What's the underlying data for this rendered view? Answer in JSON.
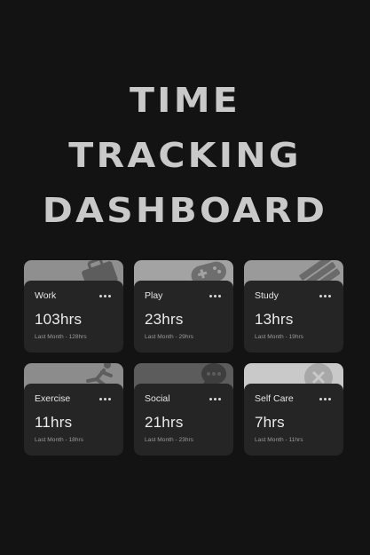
{
  "title": {
    "line1": "TIME",
    "line2": "TRACKING",
    "line3": "DASHBOARD"
  },
  "cards": [
    {
      "category": "Work",
      "current": "103hrs",
      "previous": "Last Month - 128hrs",
      "band_color": "#8f8f8f",
      "icon": "briefcase-icon"
    },
    {
      "category": "Play",
      "current": "23hrs",
      "previous": "Last Month - 29hrs",
      "band_color": "#a3a3a3",
      "icon": "gamepad-icon"
    },
    {
      "category": "Study",
      "current": "13hrs",
      "previous": "Last Month - 19hrs",
      "band_color": "#9a9a9a",
      "icon": "book-icon"
    },
    {
      "category": "Exercise",
      "current": "11hrs",
      "previous": "Last Month - 18hrs",
      "band_color": "#8c8c8c",
      "icon": "running-icon"
    },
    {
      "category": "Social",
      "current": "21hrs",
      "previous": "Last Month - 23hrs",
      "band_color": "#5c5c5c",
      "icon": "chat-icon"
    },
    {
      "category": "Self Care",
      "current": "7hrs",
      "previous": "Last Month - 11hrs",
      "band_color": "#c9c9c9",
      "icon": "heart-care-icon"
    }
  ]
}
